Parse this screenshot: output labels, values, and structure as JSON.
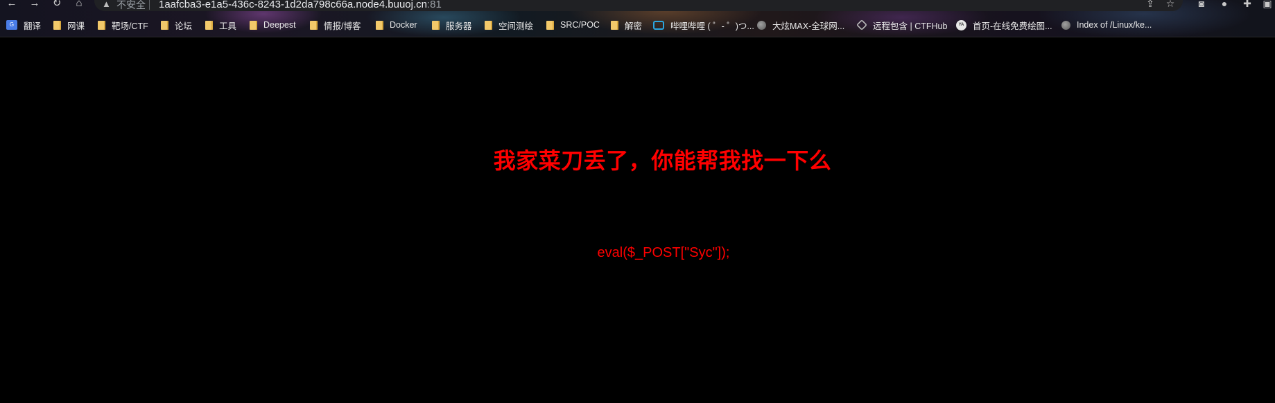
{
  "browser": {
    "security_label": "不安全",
    "url_host": "1aafcba3-e1a5-436c-8243-1d2da798c66a.node4.buuoj.cn",
    "url_port": ":81",
    "nav": {
      "back": "←",
      "forward": "→",
      "reload": "↻",
      "home": "⌂"
    },
    "right_icons": {
      "share": "⇪",
      "star": "☆",
      "reader": "◙",
      "profile": "●",
      "extensions": "✚",
      "split": "▣"
    }
  },
  "bookmarks": [
    {
      "label": "翻译",
      "icon": "translate-icon",
      "icon_text": "G"
    },
    {
      "label": "网课",
      "icon": "folder-icon"
    },
    {
      "label": "靶场/CTF",
      "icon": "folder-icon"
    },
    {
      "label": "论坛",
      "icon": "folder-icon"
    },
    {
      "label": "工具",
      "icon": "folder-icon"
    },
    {
      "label": "Deepest",
      "icon": "folder-icon"
    },
    {
      "label": "情报/博客",
      "icon": "folder-icon"
    },
    {
      "label": "Docker",
      "icon": "folder-icon"
    },
    {
      "label": "服务器",
      "icon": "folder-icon"
    },
    {
      "label": "空间测绘",
      "icon": "folder-icon"
    },
    {
      "label": "SRC/POC",
      "icon": "folder-icon"
    },
    {
      "label": "解密",
      "icon": "folder-icon"
    },
    {
      "label": "哔哩哔哩 ( ゜- ゜)つ...",
      "icon": "bili-icon"
    },
    {
      "label": "大炫MAX-全球网...",
      "icon": "globe-icon"
    },
    {
      "label": "远程包含 | CTFHub",
      "icon": "hub-icon"
    },
    {
      "label": "首页-在线免费绘图...",
      "icon": "ya-icon",
      "icon_text": "YA"
    },
    {
      "label": "Index of /Linux/ke...",
      "icon": "globe-icon"
    }
  ],
  "page": {
    "heading": "我家菜刀丢了，你能帮我找一下么",
    "code": "eval($_POST[\"Syc\"]);",
    "text_color": "#ff0000",
    "background_color": "#000000"
  }
}
